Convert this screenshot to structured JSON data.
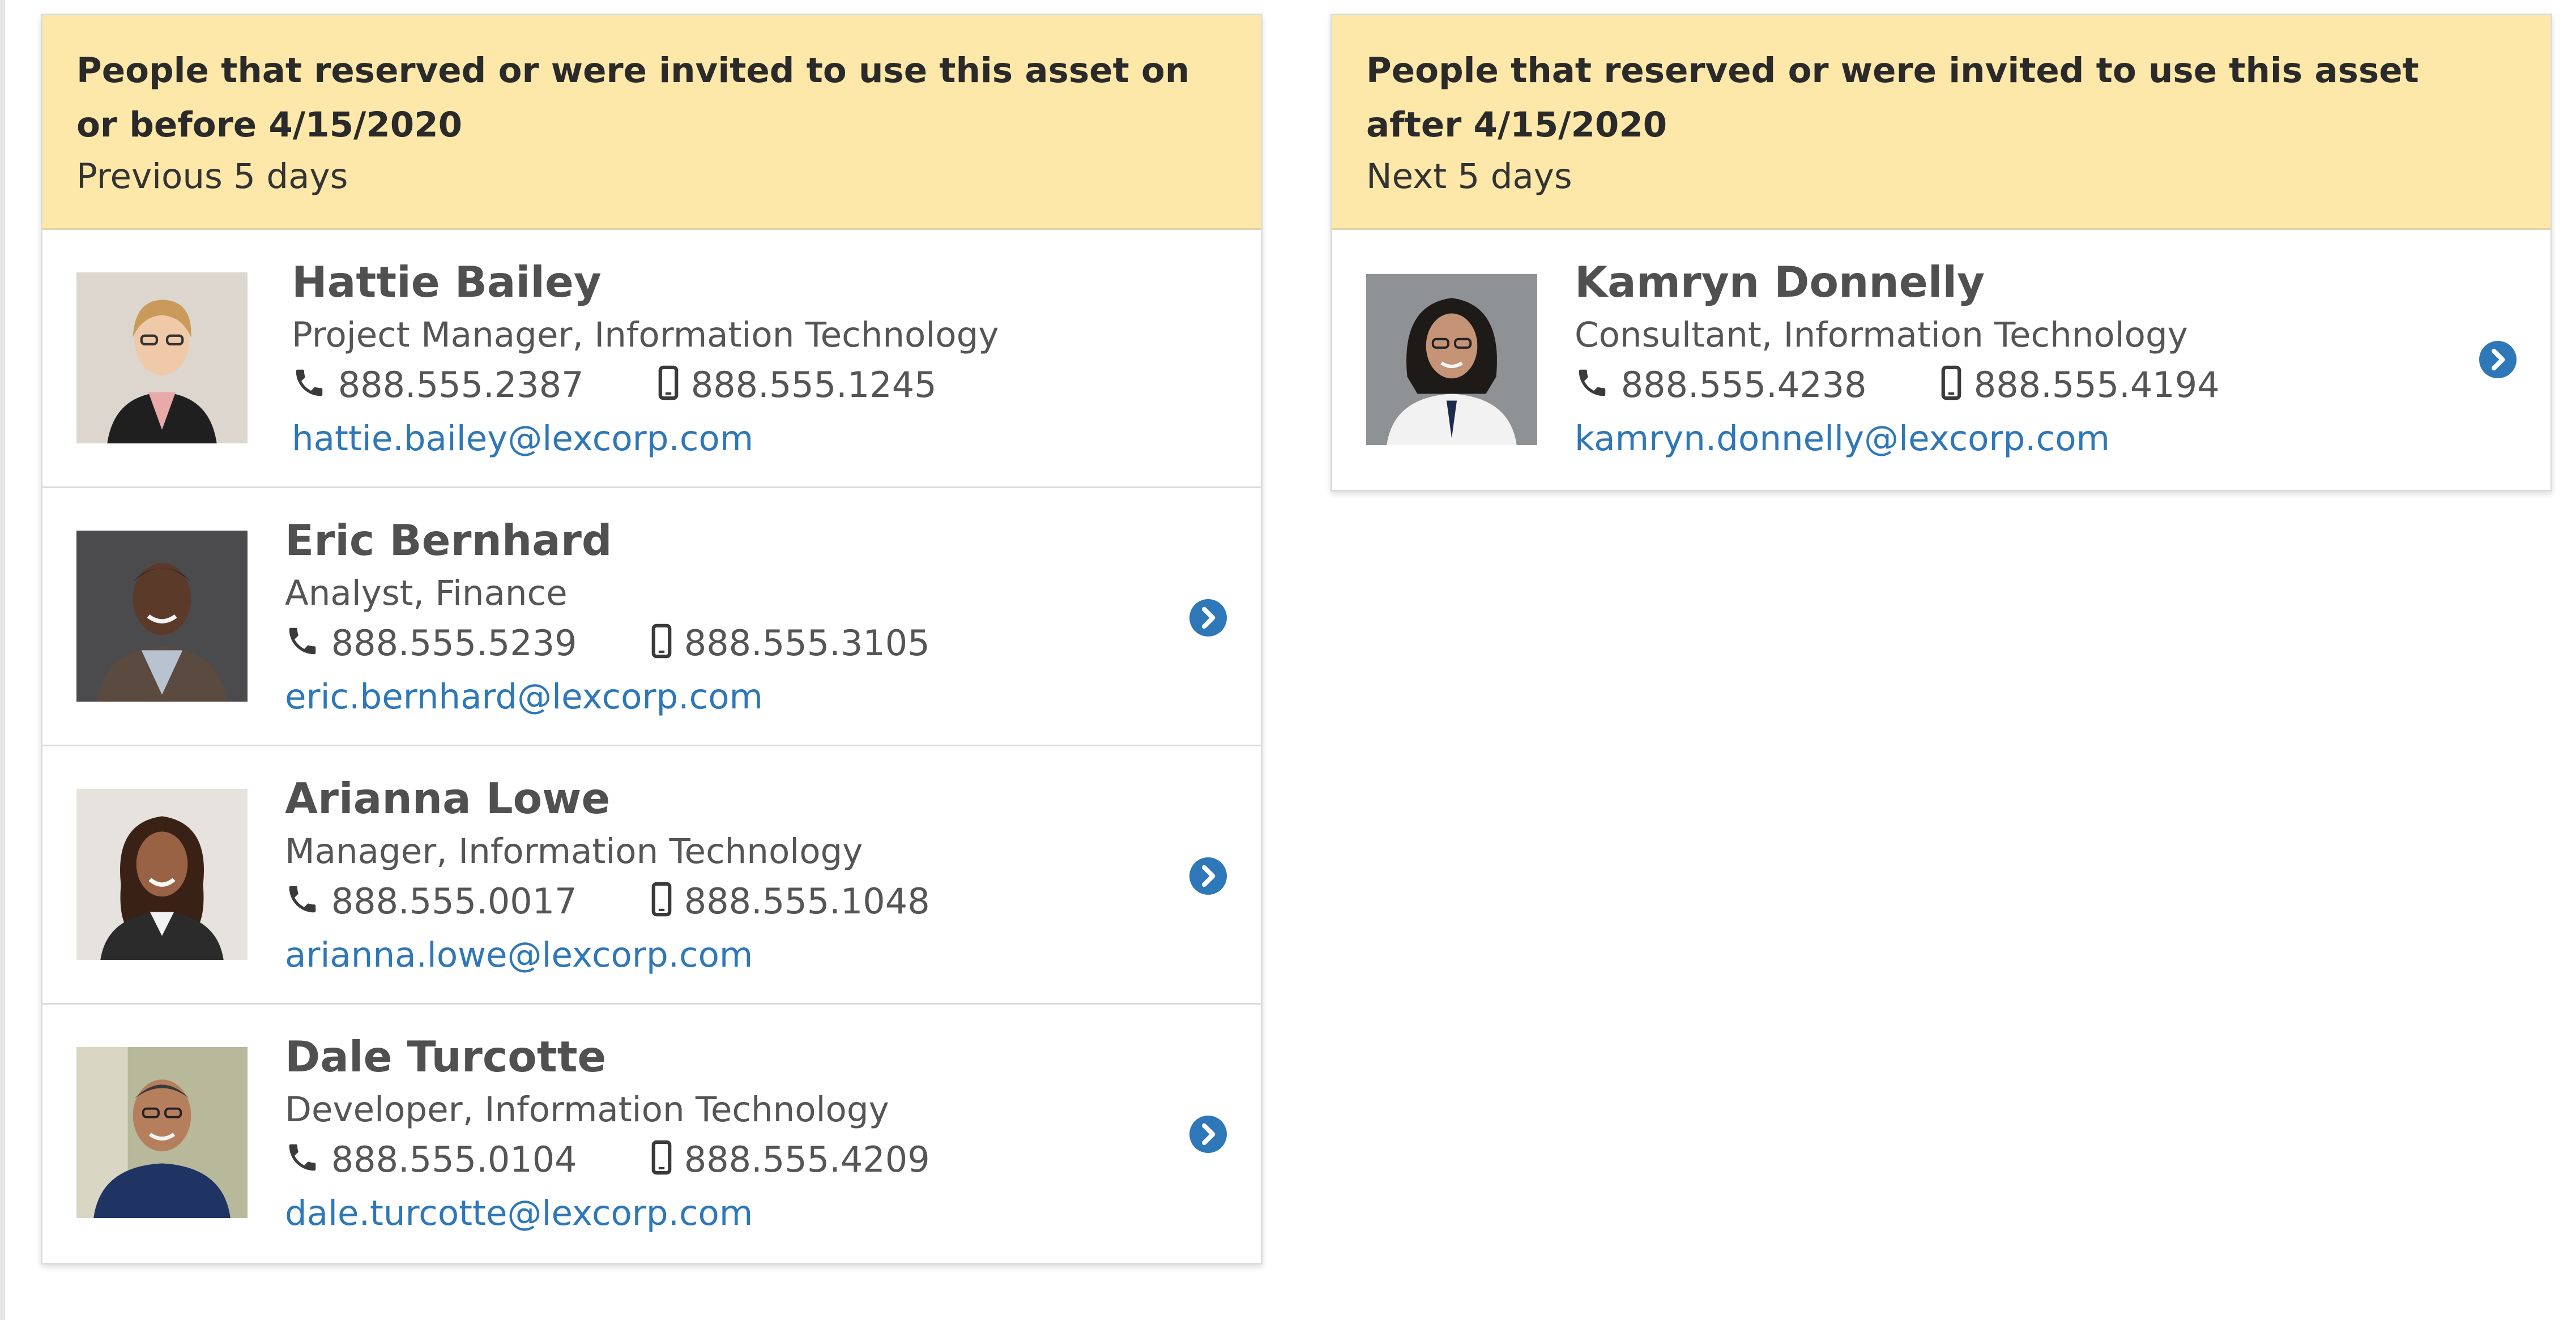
{
  "panels": [
    {
      "title": "People that reserved or were invited to use this asset on or before 4/15/2020",
      "subtitle": "Previous 5 days",
      "people": [
        {
          "name": "Hattie Bailey",
          "role": "Project Manager, Information Technology",
          "phone": "888.555.2387",
          "mobile": "888.555.1245",
          "email": "hattie.bailey@lexcorp.com"
        },
        {
          "name": "Eric Bernhard",
          "role": "Analyst, Finance",
          "phone": "888.555.5239",
          "mobile": "888.555.3105",
          "email": "eric.bernhard@lexcorp.com"
        },
        {
          "name": "Arianna Lowe",
          "role": "Manager, Information Technology",
          "phone": "888.555.0017",
          "mobile": "888.555.1048",
          "email": "arianna.lowe@lexcorp.com"
        },
        {
          "name": "Dale Turcotte",
          "role": "Developer, Information Technology",
          "phone": "888.555.0104",
          "mobile": "888.555.4209",
          "email": "dale.turcotte@lexcorp.com"
        }
      ]
    },
    {
      "title": "People that reserved or were invited to use this asset after 4/15/2020",
      "subtitle": "Next 5 days",
      "people": [
        {
          "name": "Kamryn Donnelly",
          "role": "Consultant, Information Technology",
          "phone": "888.555.4238",
          "mobile": "888.555.4194",
          "email": "kamryn.donnelly@lexcorp.com"
        }
      ]
    }
  ],
  "icons": {
    "phone": "phone-icon",
    "mobile": "mobile-phone-icon",
    "row_action": "chevron-right-circle-icon"
  },
  "colors": {
    "header_bg": "#fde8a9",
    "link": "#2e77b8",
    "chevron": "#2e77b8",
    "text": "#555555"
  }
}
